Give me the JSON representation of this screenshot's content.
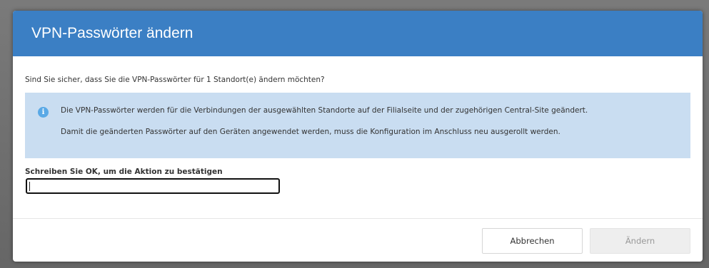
{
  "dialog": {
    "title": "VPN-Passwörter ändern",
    "question": "Sind Sie sicher, dass Sie die VPN-Passwörter für 1 Standort(e) ändern möchten?",
    "info": {
      "icon": "info-icon",
      "line1": "Die VPN-Passwörter werden für die Verbindungen der ausgewählten Standorte auf der Filialseite und der zugehörigen Central-Site geändert.",
      "line2": "Damit die geänderten Passwörter auf den Geräten angewendet werden, muss die Konfiguration im Anschluss neu ausgerollt werden."
    },
    "confirm": {
      "label": "Schreiben Sie OK, um die Aktion zu bestätigen",
      "value": ""
    },
    "buttons": {
      "cancel": "Abbrechen",
      "change": "Ändern"
    }
  },
  "colors": {
    "header": "#3b7fc4",
    "info_background": "#c9ddf1",
    "info_icon": "#5aa9e6"
  }
}
